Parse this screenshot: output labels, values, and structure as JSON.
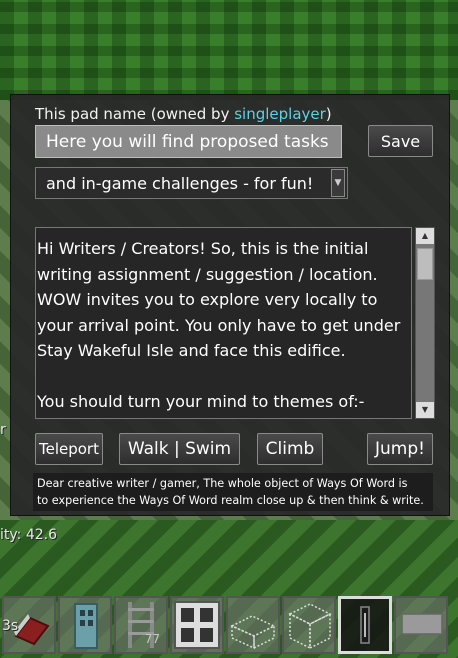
{
  "hud": {
    "left_text_1": "r",
    "left_text_2": "ity: 42.6",
    "left_text_3": "3s"
  },
  "dialog": {
    "owner_prefix": "This pad name (owned by ",
    "owner_name": "singleplayer",
    "owner_suffix": ")",
    "name_value": "Here you will find proposed tasks",
    "save_label": "Save",
    "dropdown_value": "and in-game challenges - for fun!",
    "text_line_1": "Hi Writers / Creators! So, this is the initial",
    "text_line_2": "writing assignment / suggestion / location.",
    "text_line_3": "WOW invites you to explore very locally to",
    "text_line_4": "your arrival point. You only have to get under",
    "text_line_5": "Stay Wakeful Isle and face this edifice.",
    "text_line_7": "You should turn your mind to themes of:-",
    "buttons": {
      "teleport": "Teleport",
      "walk_swim": "Walk | Swim",
      "climb": "Climb",
      "jump": "Jump!"
    },
    "info_line_1": "Dear creative writer / gamer, The whole object of Ways Of Word is",
    "info_line_2": "to experience the Ways Of Word realm close up & then think & write."
  },
  "hotbar": {
    "slot_3_count": "77"
  },
  "colors": {
    "owner_name": "#5fd0e8",
    "dialog_bg": "#282828"
  }
}
